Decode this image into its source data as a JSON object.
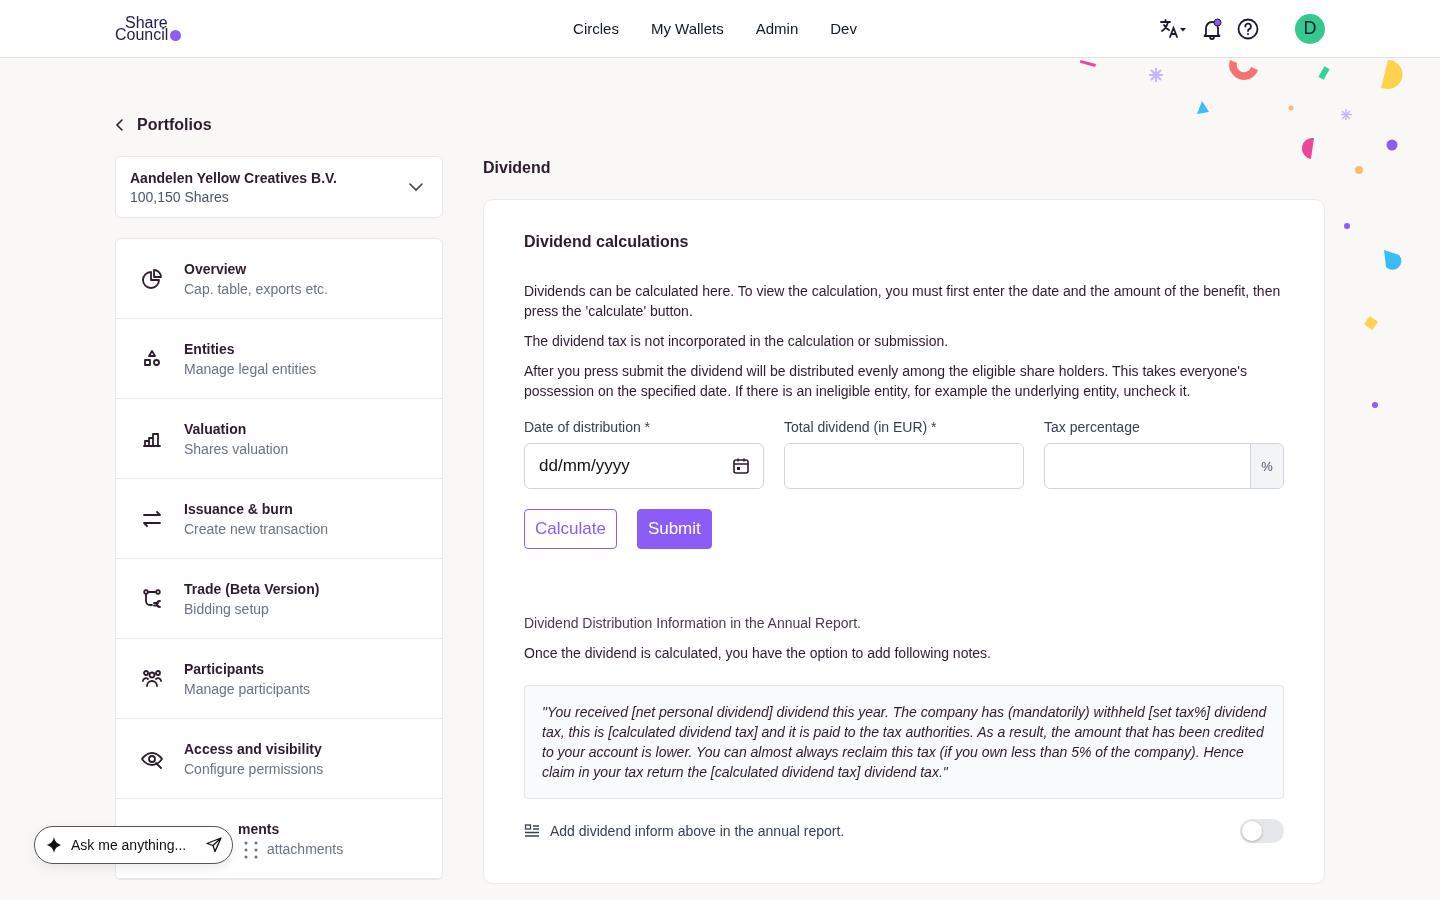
{
  "header": {
    "logo": {
      "line1": "Share",
      "line2": "Council"
    },
    "nav": [
      {
        "label": "Circles"
      },
      {
        "label": "My Wallets"
      },
      {
        "label": "Admin"
      },
      {
        "label": "Dev"
      }
    ],
    "notifications": {
      "unread": true
    },
    "avatar": {
      "initial": "D"
    }
  },
  "back_link": {
    "label": "Portfolios"
  },
  "portfolio_select": {
    "name": "Aandelen Yellow Creatives B.V.",
    "shares": "100,150 Shares"
  },
  "sidebar": {
    "items": [
      {
        "title": "Overview",
        "subtitle": "Cap. table, exports etc."
      },
      {
        "title": "Entities",
        "subtitle": "Manage legal entities"
      },
      {
        "title": "Valuation",
        "subtitle": "Shares valuation"
      },
      {
        "title": "Issuance & burn",
        "subtitle": "Create new transaction"
      },
      {
        "title": "Trade (Beta Version)",
        "subtitle": "Bidding setup"
      },
      {
        "title": "Participants",
        "subtitle": "Manage participants"
      },
      {
        "title": "Access and visibility",
        "subtitle": "Configure permissions"
      },
      {
        "kind": "covered",
        "title": "ments",
        "subtitle": "attachments"
      }
    ]
  },
  "page_title": "Dividend",
  "card": {
    "title": "Dividend calculations",
    "paragraphs": [
      "Dividends can be calculated here. To view the calculation, you must first enter the date and the amount of the benefit, then press the 'calculate' button.",
      "The dividend tax is not incorporated in the calculation or submission.",
      "After you press submit the dividend will be distributed evenly among the eligible share holders. This takes everyone's possession on the specified date. If there is an ineligible entity, for example the underlying entity, uncheck it."
    ],
    "fields": [
      {
        "kind": "date",
        "label": "Date of distribution *",
        "placeholder": "dd/mm/yyyy"
      },
      {
        "kind": "text",
        "label": "Total dividend (in EUR) *"
      },
      {
        "kind": "percent",
        "label": "Tax percentage",
        "suffix": "%"
      }
    ],
    "buttons": [
      {
        "kind": "outline",
        "label": "Calculate"
      },
      {
        "kind": "primary",
        "label": "Submit"
      }
    ],
    "annual_report": {
      "heading": "Dividend Distribution Information in the Annual Report.",
      "intro": "Once the dividend is calculated, you have the option to add following notes.",
      "quote": "\"You received [net personal dividend] dividend this year. The company has (mandatorily) withheld [set tax%] dividend tax, this is [calculated dividend tax] and it is paid to the tax authorities. As a result, the amount that has been credited to your account is lower. You can almost always reclaim this tax (if you own less than 5% of the company). Hence claim in your tax return the [calculated dividend tax] dividend tax.\"",
      "toggle": {
        "label": "Add dividend inform above in the annual report.",
        "on": false
      }
    }
  },
  "chat": {
    "placeholder": "Ask me anything..."
  }
}
